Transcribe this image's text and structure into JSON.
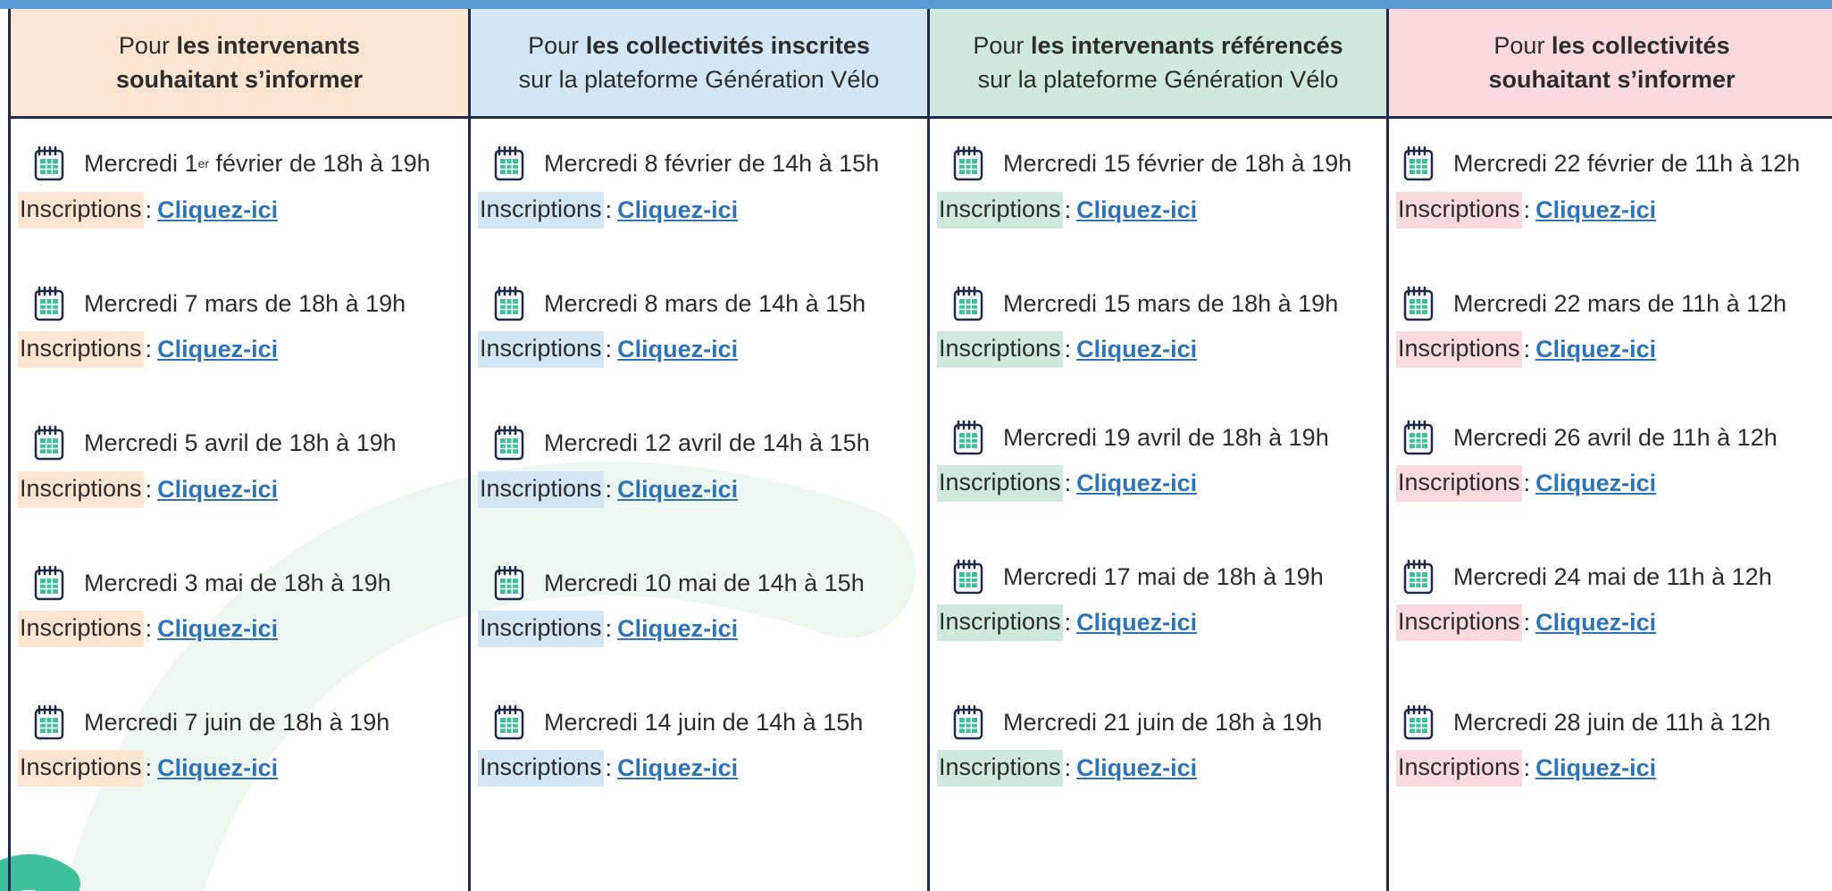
{
  "colors": {
    "border": "#1e2a48",
    "top_bar": "#5b9bd5",
    "link": "#2e74b5",
    "col_orange": "#fde5d1",
    "col_blue": "#d2e6f6",
    "col_green": "#cfe9de",
    "col_pink": "#fadade"
  },
  "icons": {
    "date": "calendar-icon"
  },
  "columns": [
    {
      "head": {
        "prefix": "Pour",
        "bold1": "les intervenants",
        "bold2": "souhaitant s’informer",
        "rest": ""
      },
      "sessions": [
        {
          "date": "Mercredi 1",
          "sup": "er",
          "date_rest": " février de 18h à 19h",
          "label": "Inscriptions",
          "sep": ":",
          "link": "Cliquez-ici"
        },
        {
          "date": "Mercredi 7 mars de 18h à 19h",
          "label": "Inscriptions",
          "sep": ":",
          "link": "Cliquez-ici"
        },
        {
          "date": "Mercredi 5 avril de 18h à 19h",
          "label": "Inscriptions",
          "sep": ":",
          "link": "Cliquez-ici"
        },
        {
          "date": "Mercredi 3 mai de 18h à 19h",
          "label": "Inscriptions",
          "sep": ":",
          "link": "Cliquez-ici"
        },
        {
          "date": "Mercredi 7 juin de 18h à 19h",
          "label": "Inscriptions",
          "sep": ":",
          "link": "Cliquez-ici"
        }
      ]
    },
    {
      "head": {
        "prefix": "Pour",
        "bold1": "les collectivités inscrites",
        "bold2": "",
        "rest": "sur la plateforme Génération Vélo"
      },
      "sessions": [
        {
          "date": "Mercredi 8 février de 14h à 15h",
          "label": "Inscriptions",
          "sep": ":",
          "link": "Cliquez-ici"
        },
        {
          "date": "Mercredi 8 mars de 14h à 15h",
          "label": "Inscriptions",
          "sep": ":",
          "link": "Cliquez-ici"
        },
        {
          "date": "Mercredi 12 avril de 14h à 15h",
          "label": "Inscriptions",
          "sep": ":",
          "link": "Cliquez-ici"
        },
        {
          "date": "Mercredi 10 mai de 14h à 15h",
          "label": "Inscriptions",
          "sep": ":",
          "link": "Cliquez-ici"
        },
        {
          "date": "Mercredi 14 juin de 14h à 15h",
          "label": "Inscriptions",
          "sep": ":",
          "link": "Cliquez-ici"
        }
      ]
    },
    {
      "head": {
        "prefix": "Pour",
        "bold1": "les intervenants référencés",
        "bold2": "",
        "rest": "sur la plateforme Génération Vélo"
      },
      "sessions": [
        {
          "date": "Mercredi 15 février de 18h à 19h",
          "label": "Inscriptions",
          "sep": ":",
          "link": "Cliquez-ici"
        },
        {
          "date": "Mercredi 15 mars de 18h à 19h",
          "label": "Inscriptions",
          "sep": ":",
          "link": "Cliquez-ici"
        },
        {
          "date": "Mercredi 19 avril de 18h à 19h",
          "label": "Inscriptions",
          "sep": ":",
          "link": "Cliquez-ici"
        },
        {
          "date": "Mercredi 17 mai de 18h à 19h",
          "label": "Inscriptions",
          "sep": ":",
          "link": "Cliquez-ici"
        },
        {
          "date": "Mercredi 21 juin de 18h à 19h",
          "label": "Inscriptions",
          "sep": ":",
          "link": "Cliquez-ici"
        }
      ]
    },
    {
      "head": {
        "prefix": "Pour",
        "bold1": "les collectivités",
        "bold2": "souhaitant s’informer",
        "rest": ""
      },
      "sessions": [
        {
          "date": "Mercredi 22 février de 11h à 12h",
          "label": "Inscriptions",
          "sep": ":",
          "link": "Cliquez-ici"
        },
        {
          "date": "Mercredi 22 mars de 11h à 12h",
          "label": "Inscriptions",
          "sep": ":",
          "link": "Cliquez-ici"
        },
        {
          "date": "Mercredi 26 avril de 11h à 12h",
          "label": "Inscriptions",
          "sep": ":",
          "link": "Cliquez-ici"
        },
        {
          "date": "Mercredi 24 mai de 11h à 12h",
          "label": "Inscriptions",
          "sep": ":",
          "link": "Cliquez-ici"
        },
        {
          "date": "Mercredi 28 juin de 11h à 12h",
          "label": "Inscriptions",
          "sep": ":",
          "link": "Cliquez-ici"
        }
      ]
    }
  ]
}
